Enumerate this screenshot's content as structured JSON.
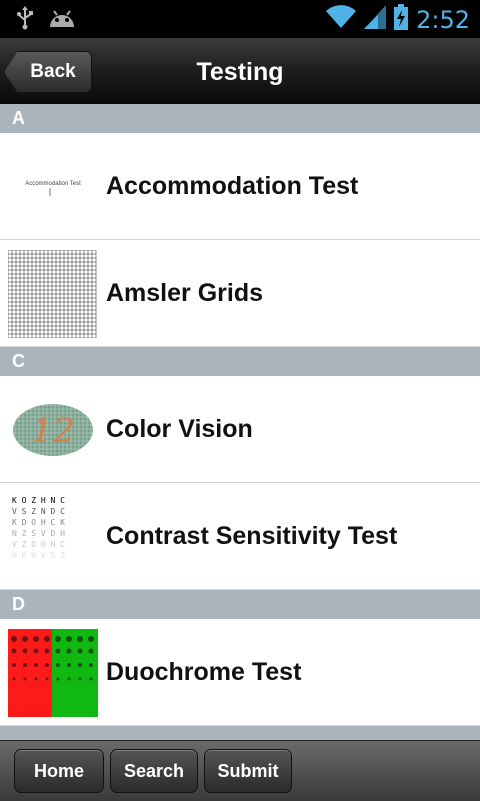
{
  "status_bar": {
    "time": "2:52",
    "icons": [
      "usb-icon",
      "android-icon",
      "wifi-icon",
      "signal-icon",
      "battery-charging-icon"
    ],
    "accent_color": "#4fb3e8"
  },
  "header": {
    "back_label": "Back",
    "title": "Testing"
  },
  "list": {
    "sections": [
      {
        "letter": "A",
        "items": [
          {
            "label": "Accommodation Test",
            "thumb": "accommodation-test-thumbnail"
          },
          {
            "label": "Amsler Grids",
            "thumb": "amsler-grid-thumbnail"
          }
        ]
      },
      {
        "letter": "C",
        "items": [
          {
            "label": "Color Vision",
            "thumb": "color-vision-plate-thumbnail"
          },
          {
            "label": "Contrast Sensitivity Test",
            "thumb": "contrast-chart-thumbnail"
          }
        ]
      },
      {
        "letter": "D",
        "items": [
          {
            "label": "Duochrome Test",
            "thumb": "duochrome-thumbnail"
          }
        ]
      }
    ]
  },
  "toolbar": {
    "home_label": "Home",
    "search_label": "Search",
    "submit_label": "Submit"
  },
  "colors": {
    "section_header": "#aab4bd",
    "duochrome_red": "#ff1a1a",
    "duochrome_green": "#11b811",
    "color_plate_number": "#e07a3c"
  },
  "thumb_text": {
    "accommodation_chart": "Accommodation Test",
    "color_plate_number": "12",
    "contrast_letters": [
      "K O Z H N C",
      "V S Z N D C",
      "K D O H C K",
      "N Z S V D H",
      "V Z D O N C",
      "H K N V S Z"
    ]
  }
}
